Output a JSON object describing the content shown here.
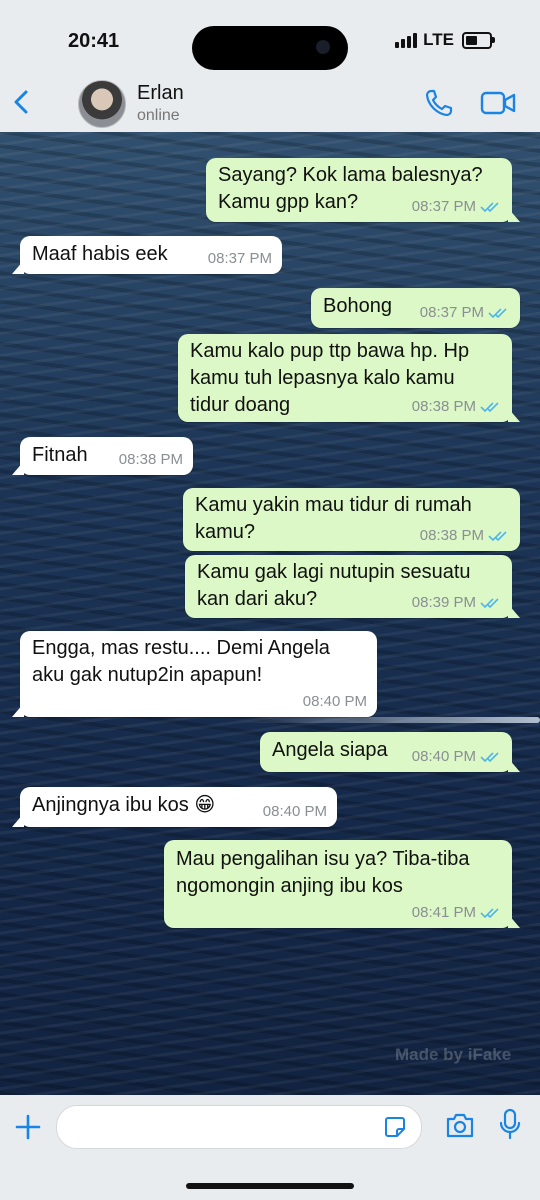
{
  "status_bar": {
    "time": "20:41",
    "network": "LTE"
  },
  "header": {
    "contact_name": "Erlan",
    "contact_status": "online"
  },
  "messages": [
    {
      "dir": "out",
      "text": "Sayang? Kok lama balesnya?\nKamu gpp kan?",
      "time": "08:37 PM"
    },
    {
      "dir": "in",
      "text": "Maaf habis eek",
      "time": "08:37 PM"
    },
    {
      "dir": "out",
      "text": "Bohong",
      "time": "08:37 PM"
    },
    {
      "dir": "out",
      "text": "Kamu kalo pup ttp bawa hp. Hp\nkamu tuh lepasnya kalo kamu\ntidur doang",
      "time": "08:38 PM"
    },
    {
      "dir": "in",
      "text": "Fitnah",
      "time": "08:38 PM"
    },
    {
      "dir": "out",
      "text": "Kamu yakin mau tidur di rumah\nkamu?",
      "time": "08:38 PM"
    },
    {
      "dir": "out",
      "text": "Kamu gak lagi nutupin sesuatu\nkan dari aku?",
      "time": "08:39 PM"
    },
    {
      "dir": "in",
      "text": "Engga, mas restu.... Demi Angela\naku gak nutup2in apapun!",
      "time": "08:40 PM"
    },
    {
      "dir": "out",
      "text": "Angela siapa",
      "time": "08:40 PM"
    },
    {
      "dir": "in",
      "text": "Anjingnya ibu kos 😁",
      "time": "08:40 PM"
    },
    {
      "dir": "out",
      "text": "Mau pengalihan isu ya? Tiba-tiba\nngomongin anjing ibu kos",
      "time": "08:41 PM"
    }
  ],
  "watermark": "Made by iFake",
  "icons": {
    "back": "chevron-left-icon",
    "phone": "phone-icon",
    "video": "video-camera-icon",
    "plus": "plus-icon",
    "sticker": "sticker-icon",
    "camera": "camera-icon",
    "mic": "microphone-icon",
    "read": "double-check-icon"
  },
  "colors": {
    "accent": "#1a84e6",
    "outgoing_bubble": "#dcf8c6",
    "incoming_bubble": "#ffffff",
    "read_ticks": "#4fb6ec"
  }
}
